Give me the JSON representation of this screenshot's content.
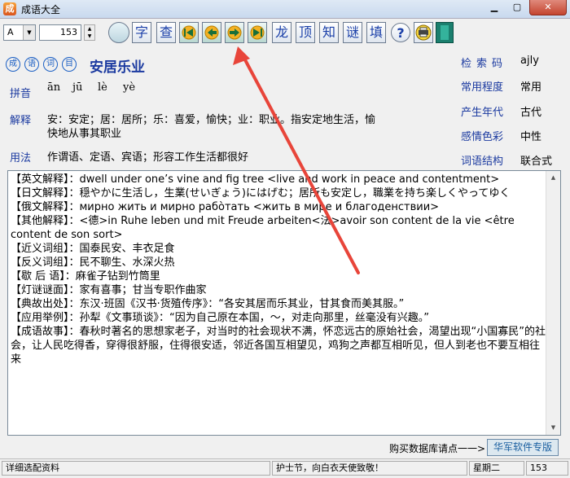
{
  "window": {
    "title": "成语大全",
    "icon_glyph": "成"
  },
  "toolbar": {
    "font_selected": "A",
    "number_value": "153",
    "buttons": [
      {
        "name": "zi",
        "label": "字"
      },
      {
        "name": "cha",
        "label": "查"
      },
      {
        "name": "long",
        "label": "龙"
      },
      {
        "name": "ding",
        "label": "顶"
      },
      {
        "name": "zhi",
        "label": "知"
      },
      {
        "name": "mi",
        "label": "谜"
      },
      {
        "name": "tian",
        "label": "填"
      },
      {
        "name": "help",
        "label": "?"
      }
    ]
  },
  "header": {
    "badges": [
      "成",
      "语",
      "词",
      "目"
    ],
    "idiom": "安居乐业",
    "pinyin_label": "拼音",
    "pinyin": [
      "ān",
      "jū",
      "lè",
      "yè"
    ],
    "jieshi_label": "解释",
    "jieshi_line1": "安：安定；居：居所；乐：喜爱，愉快；业：职业。指安定地生活，愉",
    "jieshi_line2": "快地从事其职业",
    "yongfa_label": "用法",
    "yongfa": "作谓语、定语、宾语；形容工作生活都很好",
    "props": [
      {
        "label": "检索码",
        "value": "ajly"
      },
      {
        "label": "常用程度",
        "value": "常用"
      },
      {
        "label": "产生年代",
        "value": "古代"
      },
      {
        "label": "感情色彩",
        "value": "中性"
      },
      {
        "label": "词语结构",
        "value": "联合式"
      }
    ]
  },
  "details": [
    "【英文解释】：dwell under one’s vine and fig tree <live and work in peace and contentment>",
    "【日文解释】：穏やかに生活し，生業(せいぎょう)にはげむ；居所も安定し，職業を持ち楽しくやってゆく",
    "【俄文解释】：мирно жить и мирно рабо̀тать <жить в мире и благоденствии>",
    "【其他解释】：<德>in Ruhe leben und mit Freude arbeiten<法>avoir son content de la vie <être content de son sort>",
    "【近义词组】：国泰民安、丰衣足食",
    "【反义词组】：民不聊生、水深火热",
    "【歇 后 语】：麻雀子钻到竹筒里",
    "【灯谜谜面】：家有喜事；甘当专职作曲家",
    "【典故出处】：东汉·班固《汉书·货殖传序》：“各安其居而乐其业，甘其食而美其服。”",
    "【应用举例】：孙犁《文事琐谈》：“因为自己原在本国，～，对走向那里，丝毫没有兴趣。”",
    "【成语故事】：春秋时著名的思想家老子，对当时的社会现状不满，怀恋远古的原始社会，渴望出现“小国寡民”的社会，让人民吃得香，穿得很舒服，住得很安适，邻近各国互相望见，鸡狗之声都互相听见，但人到老也不要互相往来"
  ],
  "footer": {
    "buy_text": "购买数据库请点一一>",
    "brand_button": "华军软件专版"
  },
  "status": {
    "left": "详细选配资料",
    "center": "护士节，向白衣天使致敬！",
    "day": "星期二",
    "count": "153"
  },
  "colors": {
    "accent_blue": "#1b3aa0",
    "annotation_red": "#e8453a"
  }
}
